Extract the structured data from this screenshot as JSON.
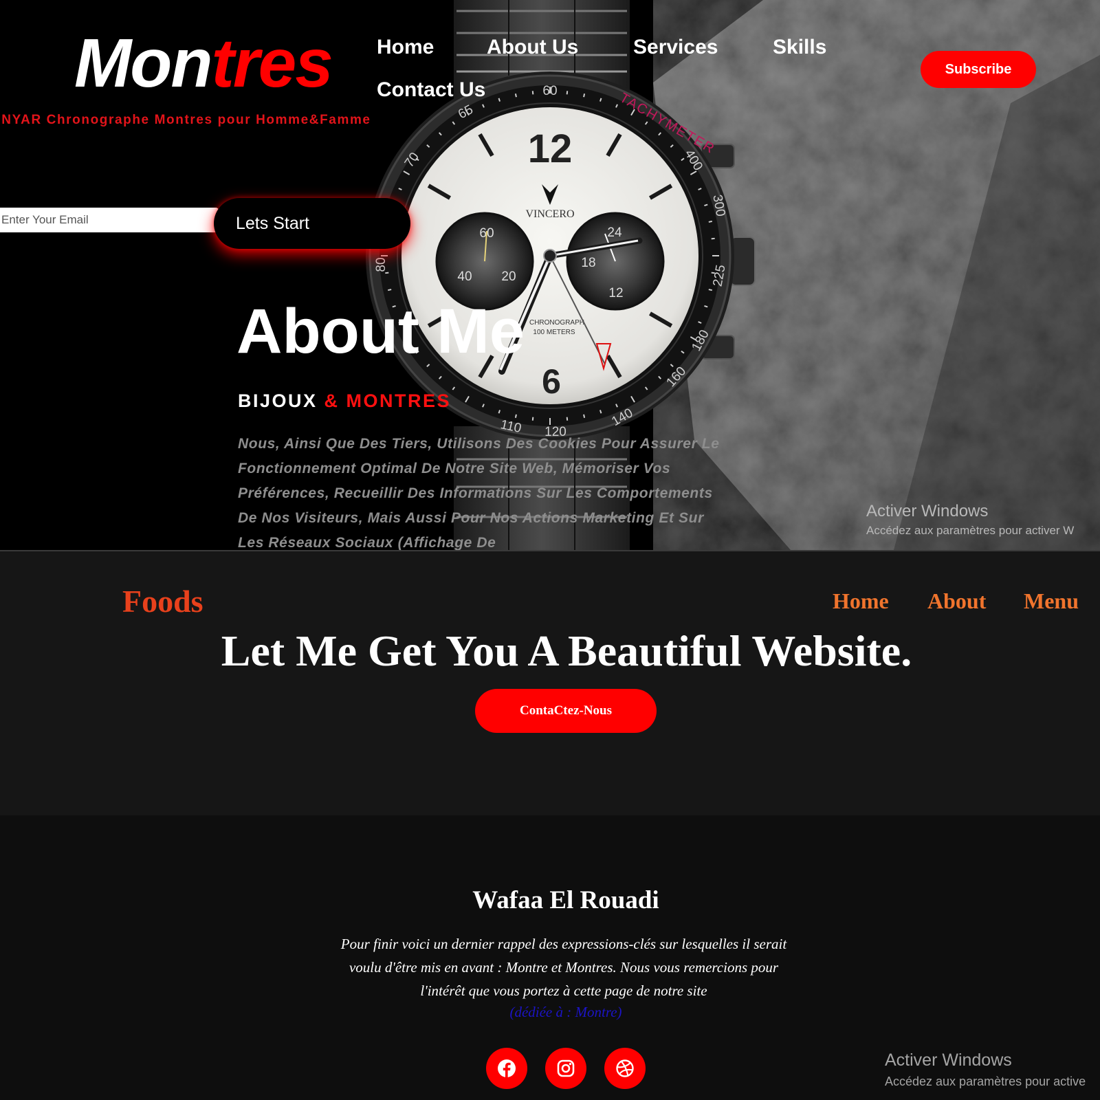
{
  "hero": {
    "brand": {
      "white": "Mon",
      "red": "tres"
    },
    "tagline": "ENYAR Chronographe Montres pour Homme&Famme",
    "nav": [
      "Home",
      "About Us",
      "Services",
      "Skills",
      "Contact Us"
    ],
    "subscribe_label": "Subscribe",
    "email_placeholder": "Enter Your Email",
    "start_label": "Lets Start",
    "about_title": "About Me",
    "subtitle": {
      "white": "BIJOUX",
      "red": "& MONTRES"
    },
    "paragraph": "Nous, Ainsi Que Des Tiers, Utilisons Des Cookies Pour Assurer Le Fonctionnement Optimal De Notre Site Web, Mémoriser Vos Préférences, Recueillir Des Informations Sur Les Comportements De Nos Visiteurs, Mais Aussi Pour Nos Actions Marketing Et Sur Les Réseaux Sociaux (Affichage De",
    "watch": {
      "brand": "VINCERO",
      "bezel_label": "TACHYMETER",
      "bezel_numbers": [
        "60",
        "65",
        "70",
        "80",
        "110",
        "120",
        "140",
        "160",
        "180",
        "225",
        "300",
        "400"
      ],
      "dial_numbers": [
        "12",
        "6"
      ],
      "left_subdial": [
        "60",
        "40",
        "20"
      ],
      "right_subdial": [
        "24",
        "18",
        "12"
      ],
      "dial_text": [
        "CHRONOGRAPH",
        "100 METERS"
      ]
    }
  },
  "windows_watermark": {
    "title": "Activer Windows",
    "hero_subtitle": "Accédez aux paramètres pour activer W",
    "footer_subtitle": "Accédez aux paramètres pour active"
  },
  "foods": {
    "logo": "Foods",
    "nav": [
      "Home",
      "About",
      "Menu"
    ],
    "title": "Let Me Get You A Beautiful Website.",
    "button_label": "ContaCtez-Nous"
  },
  "footer": {
    "name": "Wafaa El Rouadi",
    "text": "Pour finir voici un dernier rappel des expressions-clés sur lesquelles il serait voulu d'être mis en avant : Montre et Montres. Nous vous remercions pour l'intérêt que vous portez à cette page de notre site",
    "link": "(dédiée à : Montre)",
    "social_icons": [
      "facebook-icon",
      "instagram-icon",
      "dribbble-icon"
    ]
  },
  "colors": {
    "accent_red": "#ff0000",
    "foods_orange": "#f0742d",
    "foods_logo": "#e8411c",
    "foods_bg": "#161616",
    "footer_bg": "#0e0e0e",
    "link_blue": "#1c14c6"
  }
}
